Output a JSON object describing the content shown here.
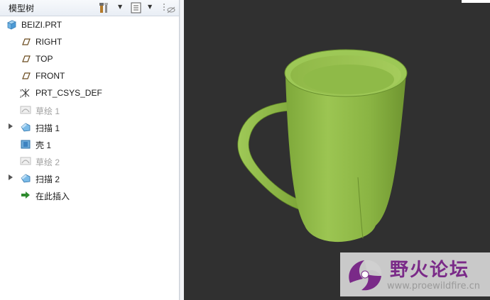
{
  "panel": {
    "title": "模型树",
    "toolbar": {
      "settings_icon": "tools-icon",
      "show_icon": "tree-columns-icon",
      "filter_icon": "filter-icon"
    }
  },
  "tree": {
    "items": [
      {
        "label": "BEIZI.PRT",
        "icon": "part-icon",
        "dim": false,
        "expandable": false
      },
      {
        "label": "RIGHT",
        "icon": "datum-plane-icon",
        "dim": false,
        "expandable": false
      },
      {
        "label": "TOP",
        "icon": "datum-plane-icon",
        "dim": false,
        "expandable": false
      },
      {
        "label": "FRONT",
        "icon": "datum-plane-icon",
        "dim": false,
        "expandable": false
      },
      {
        "label": "PRT_CSYS_DEF",
        "icon": "csys-icon",
        "dim": false,
        "expandable": false
      },
      {
        "label": "草绘 1",
        "icon": "sketch-icon",
        "dim": true,
        "expandable": false
      },
      {
        "label": "扫描 1",
        "icon": "sweep-icon",
        "dim": false,
        "expandable": true
      },
      {
        "label": "壳 1",
        "icon": "shell-icon",
        "dim": false,
        "expandable": false
      },
      {
        "label": "草绘 2",
        "icon": "sketch-icon",
        "dim": true,
        "expandable": false
      },
      {
        "label": "扫描 2",
        "icon": "sweep-icon",
        "dim": false,
        "expandable": true
      },
      {
        "label": "在此插入",
        "icon": "insert-arrow-icon",
        "dim": false,
        "expandable": false
      }
    ]
  },
  "viewport": {
    "background": "#303030",
    "model_color": "#8db640",
    "model_icon": "cup-model"
  },
  "watermark": {
    "title": "野火论坛",
    "url": "www.proewildfire.cn"
  }
}
